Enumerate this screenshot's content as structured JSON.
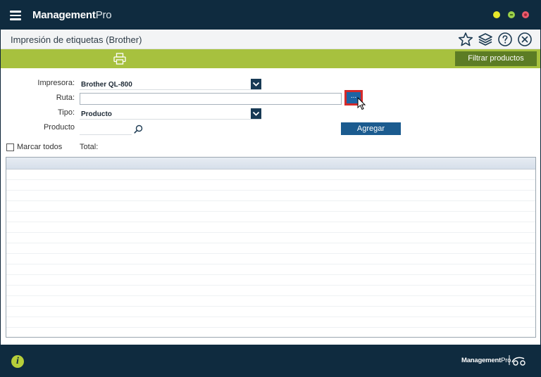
{
  "app": {
    "name_bold": "Management",
    "name_light": "Pro"
  },
  "page": {
    "title": "Impresión de etiquetas (Brother)"
  },
  "toolbar": {
    "filter_label": "Filtrar productos"
  },
  "form": {
    "printer_label": "Impresora:",
    "printer_value": "Brother QL-800",
    "path_label": "Ruta:",
    "path_value": "",
    "browse_label": "...",
    "type_label": "Tipo:",
    "type_value": "Producto",
    "product_label": "Producto",
    "product_value": "",
    "add_label": "Agregar",
    "mark_all_label": "Marcar todos",
    "total_label": "Total:"
  },
  "footer": {
    "brand_bold": "Management",
    "brand_light": "Pro",
    "info_glyph": "i"
  },
  "colors": {
    "titlebar": "#0f2b3f",
    "toolbar_green": "#a7c13e",
    "filter_button": "#5c7c24",
    "primary_button": "#1b5b8f",
    "highlight_red": "#d42a2a"
  },
  "icons": [
    "menu-icon",
    "star-icon",
    "layers-icon",
    "help-icon",
    "close-icon",
    "printer-icon",
    "chevron-down-icon",
    "search-icon",
    "info-icon"
  ]
}
